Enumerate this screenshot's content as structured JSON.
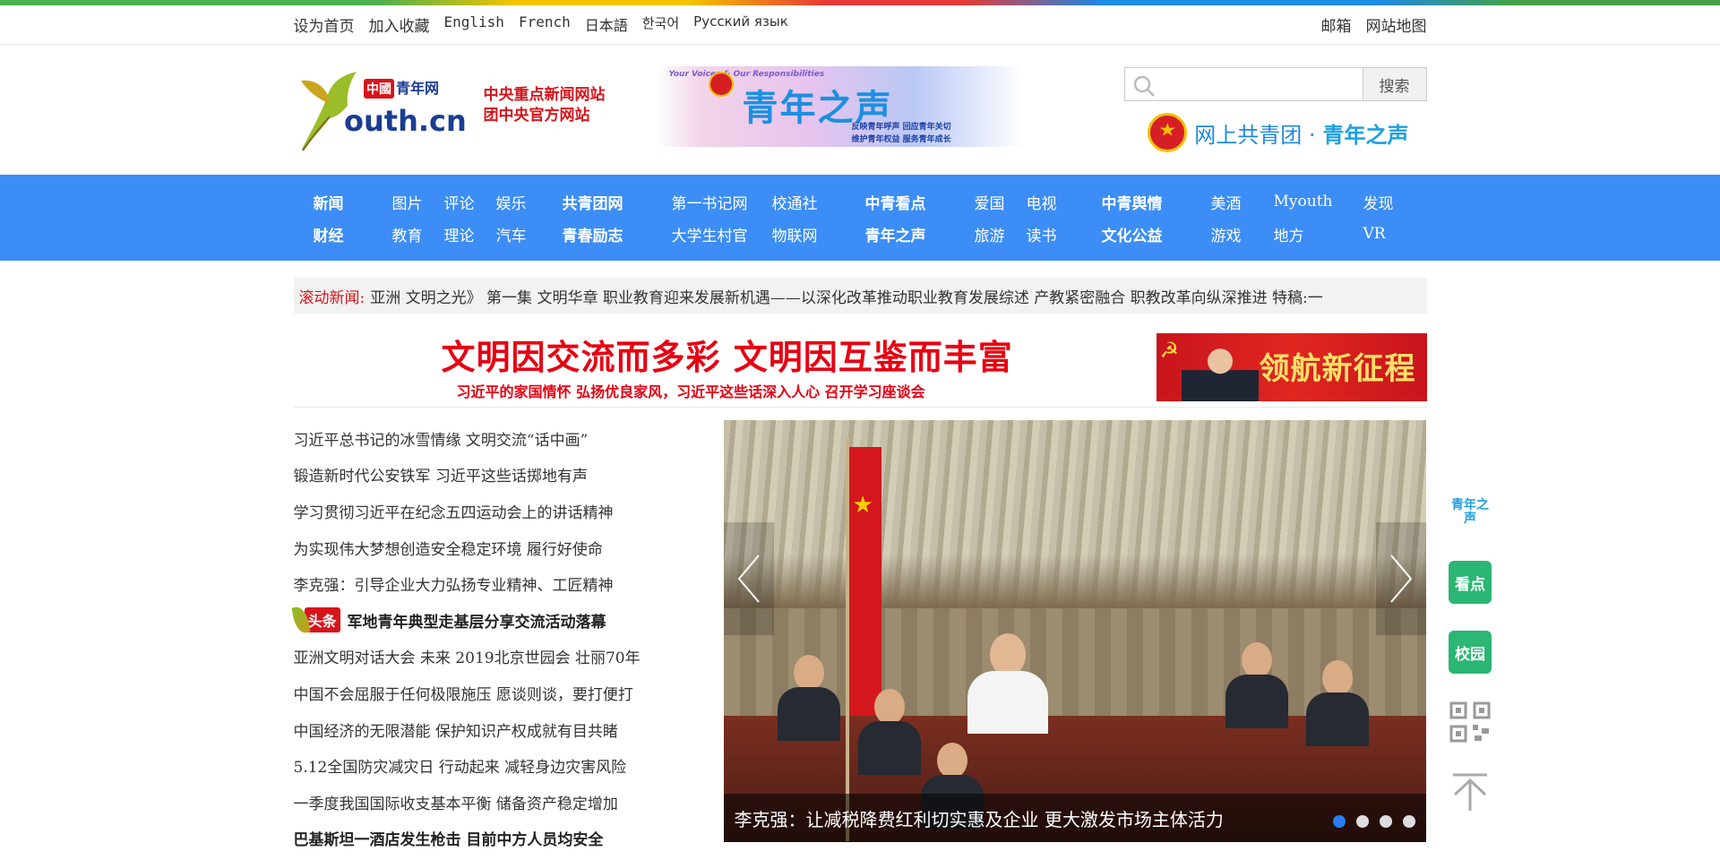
{
  "topbar": {
    "links": [
      "设为首页",
      "加入收藏",
      "English",
      "French",
      "日本語",
      "한국어",
      "Русский язык"
    ],
    "right_links": [
      "邮箱",
      "网站地图"
    ]
  },
  "header": {
    "logo_text_top": "中國青年网",
    "logo_text_main": "outh.cn",
    "slogan_1": "中央重点新闻网站",
    "slogan_2": "团中央官方网站",
    "banner_small": "Your Voices & Our Responsibilities",
    "banner_title": "青年之声",
    "banner_desc_1": "反映青年呼声 回应青年关切",
    "banner_desc_2": "维护青年权益 服务青年成长",
    "search_placeholder": "",
    "search_button": "搜索",
    "youth_voice_prefix": "网上共青团 · ",
    "youth_voice_brand": "青年之声"
  },
  "nav": {
    "groups": [
      {
        "items": [
          {
            "label": "新闻",
            "bold": true
          },
          {
            "label": "财经",
            "bold": true
          },
          {
            "label": "图片"
          },
          {
            "label": "教育"
          },
          {
            "label": "评论"
          },
          {
            "label": "理论"
          },
          {
            "label": "娱乐"
          },
          {
            "label": "汽车"
          }
        ]
      },
      {
        "items": [
          {
            "label": "共青团网",
            "bold": true
          },
          {
            "label": "青春励志",
            "bold": true
          },
          {
            "label": "第一书记网"
          },
          {
            "label": "大学生村官"
          },
          {
            "label": "校通社"
          },
          {
            "label": "物联网"
          }
        ]
      },
      {
        "items": [
          {
            "label": "中青看点",
            "bold": true
          },
          {
            "label": "青年之声",
            "bold": true
          },
          {
            "label": "爱国"
          },
          {
            "label": "旅游"
          },
          {
            "label": "电视"
          },
          {
            "label": "读书"
          }
        ]
      },
      {
        "items": [
          {
            "label": "中青舆情",
            "bold": true
          },
          {
            "label": "文化公益",
            "bold": true
          },
          {
            "label": "美酒"
          },
          {
            "label": "游戏"
          },
          {
            "label": "Myouth"
          },
          {
            "label": "地方"
          },
          {
            "label": "发现"
          },
          {
            "label": "VR"
          }
        ]
      }
    ]
  },
  "ticker": {
    "label": "滚动新闻:",
    "text": "亚洲 文明之光》 第一集 文明华章  职业教育迎来发展新机遇——以深化改革推动职业教育发展综述  产教紧密融合 职教改革向纵深推进  特稿:一"
  },
  "headline": {
    "title": "文明因交流而多彩 文明因互鉴而丰富",
    "subtitle": "习近平的家国情怀 弘扬优良家风，习近平这些话深入人心 召开学习座谈会",
    "lead_banner": "领航新征程"
  },
  "news_list": [
    {
      "text": "习近平总书记的冰雪情缘 文明交流“话中画”"
    },
    {
      "text": "锻造新时代公安铁军 习近平这些话掷地有声"
    },
    {
      "text": "学习贯彻习近平在纪念五四运动会上的讲话精神"
    },
    {
      "text": "为实现伟大梦想创造安全稳定环境 履行好使命"
    },
    {
      "text": "李克强：引导企业大力弘扬专业精神、工匠精神"
    },
    {
      "text": "军地青年典型走基层分享交流活动落幕",
      "tag": "头条",
      "bold": true
    },
    {
      "text": "亚洲文明对话大会 未来 2019北京世园会 壮丽70年"
    },
    {
      "text": "中国不会屈服于任何极限施压 愿谈则谈，要打便打"
    },
    {
      "text": "中国经济的无限潜能 保护知识产权成就有目共睹"
    },
    {
      "text": "5.12全国防灾减灾日 行动起来 减轻身边灾害风险"
    },
    {
      "text": "一季度我国国际收支基本平衡 储备资产稳定增加"
    },
    {
      "text": "巴基斯坦一酒店发生枪击 目前中方人员均安全",
      "bold": true
    }
  ],
  "slide": {
    "caption": "李克强：让减税降费红利切实惠及企业 更大激发市场主体活力",
    "dots": 4,
    "active_dot": 0
  },
  "sidebar": {
    "items": [
      {
        "label": "青年之声",
        "icon": "youth-voice-icon"
      },
      {
        "label": "看点",
        "icon": "kandian-icon"
      },
      {
        "label": "校园",
        "icon": "campus-icon"
      },
      {
        "label": "",
        "icon": "qr-code-icon"
      },
      {
        "label": "",
        "icon": "back-to-top-icon"
      }
    ]
  }
}
